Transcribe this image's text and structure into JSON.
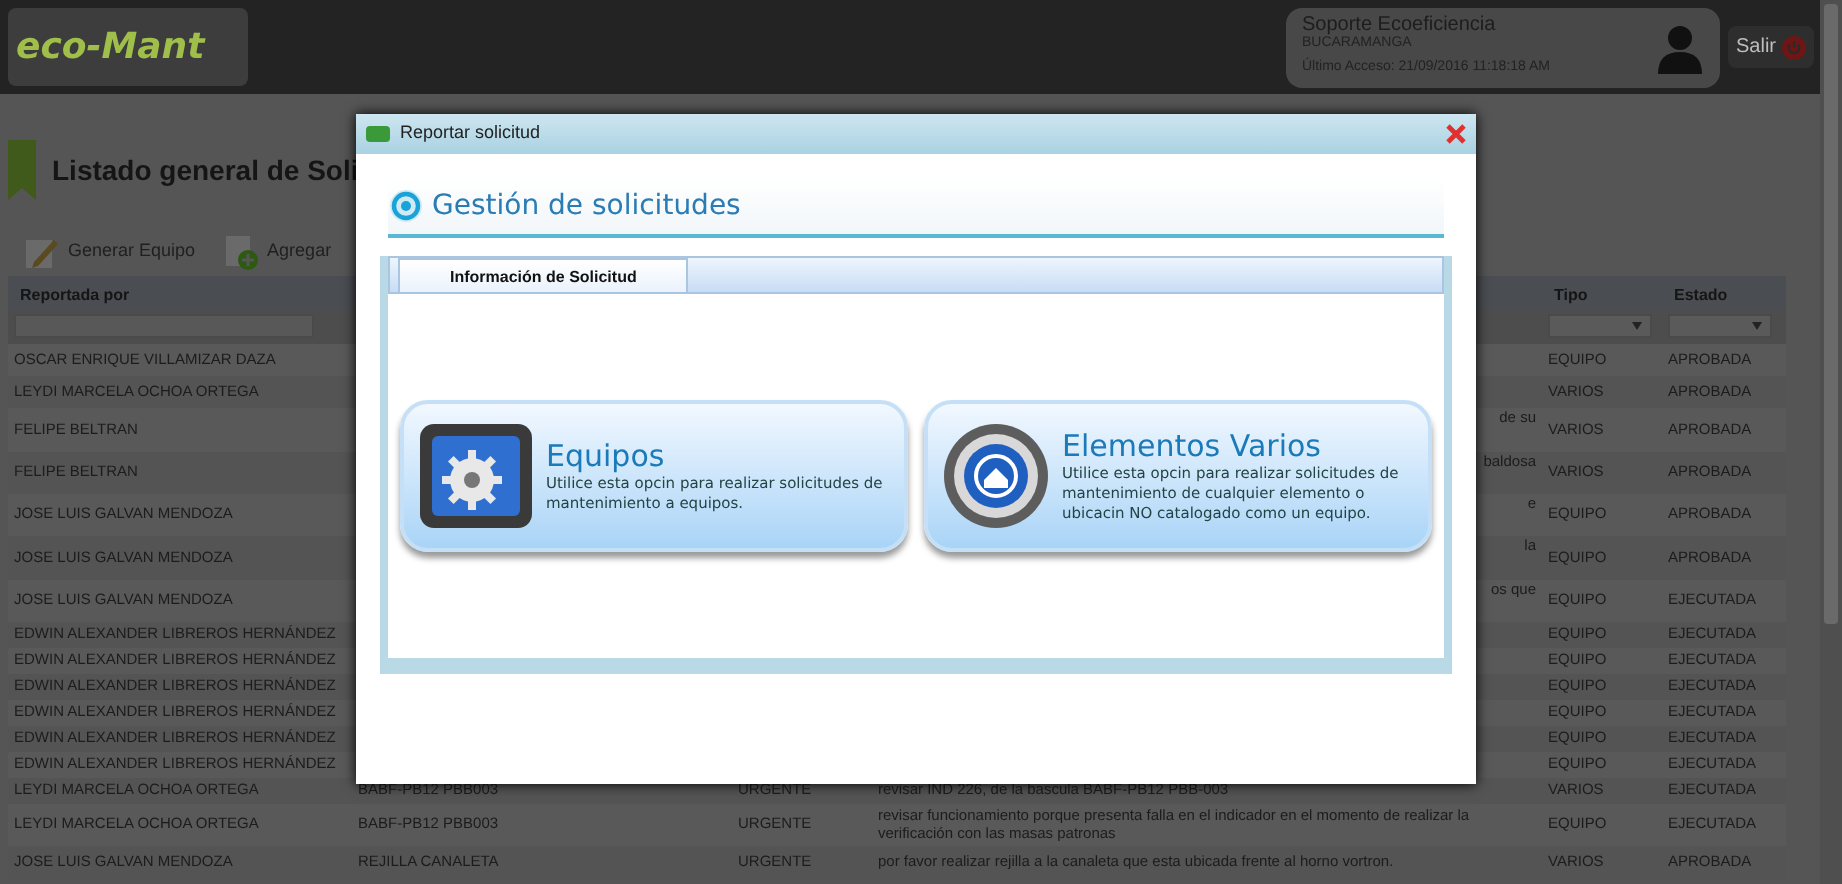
{
  "header": {
    "logo": "eco-Mant",
    "user": {
      "name": "Soporte Ecoeficiencia",
      "location": "BUCARAMANGA",
      "last_access": "Último Acceso: 21/09/2016 11:18:18 AM"
    },
    "logout": "Salir"
  },
  "page": {
    "title": "Listado general de Soli",
    "toolbar": [
      {
        "kind": "edit",
        "label": "Generar Equipo"
      },
      {
        "kind": "add",
        "label": "Agregar"
      }
    ]
  },
  "table": {
    "columns": {
      "reported_by": "Reportada por",
      "tipo": "Tipo",
      "estado": "Estado"
    },
    "rows": [
      {
        "kind": "covered",
        "reported_by": "OSCAR ENRIQUE VILLAMIZAR DAZA",
        "tipo": "EQUIPO",
        "estado": "APROBADA"
      },
      {
        "kind": "covered",
        "reported_by": "LEYDI MARCELA OCHOA ORTEGA",
        "tipo": "VARIOS",
        "estado": "APROBADA"
      },
      {
        "kind": "covered",
        "reported_by": "FELIPE BELTRAN",
        "column_4": "de su",
        "tipo": "VARIOS",
        "estado": "APROBADA"
      },
      {
        "kind": "covered",
        "reported_by": "FELIPE BELTRAN",
        "column_4": "baldosa",
        "tipo": "VARIOS",
        "estado": "APROBADA"
      },
      {
        "kind": "covered",
        "reported_by": "JOSE LUIS GALVAN MENDOZA",
        "column_4": "e",
        "tipo": "EQUIPO",
        "estado": "APROBADA"
      },
      {
        "kind": "covered",
        "reported_by": "JOSE LUIS GALVAN MENDOZA",
        "column_4": "la",
        "tipo": "EQUIPO",
        "estado": "APROBADA"
      },
      {
        "kind": "covered",
        "reported_by": "JOSE LUIS GALVAN MENDOZA",
        "column_4": "os que",
        "tipo": "EQUIPO",
        "estado": "EJECUTADA"
      },
      {
        "kind": "covered",
        "reported_by": "EDWIN ALEXANDER LIBREROS HERNÁNDEZ",
        "tipo": "EQUIPO",
        "estado": "EJECUTADA"
      },
      {
        "kind": "covered",
        "reported_by": "EDWIN ALEXANDER LIBREROS HERNÁNDEZ",
        "tipo": "EQUIPO",
        "estado": "EJECUTADA"
      },
      {
        "kind": "covered",
        "reported_by": "EDWIN ALEXANDER LIBREROS HERNÁNDEZ",
        "tipo": "EQUIPO",
        "estado": "EJECUTADA"
      },
      {
        "kind": "covered",
        "reported_by": "EDWIN ALEXANDER LIBREROS HERNÁNDEZ",
        "tipo": "EQUIPO",
        "estado": "EJECUTADA"
      },
      {
        "kind": "covered",
        "reported_by": "EDWIN ALEXANDER LIBREROS HERNÁNDEZ",
        "tipo": "EQUIPO",
        "estado": "EJECUTADA"
      },
      {
        "kind": "covered",
        "reported_by": "EDWIN ALEXANDER LIBREROS HERNÁNDEZ",
        "tipo": "EQUIPO",
        "estado": "EJECUTADA"
      },
      {
        "kind": "full",
        "reported_by": "LEYDI MARCELA OCHOA ORTEGA",
        "column_2": "BABF-PB12 PBB003",
        "column_3": "URGENTE",
        "column_4": "revisar IND 226, de la bascula BABF-PB12 PBB-003",
        "tipo": "VARIOS",
        "estado": "EJECUTADA"
      },
      {
        "kind": "full",
        "reported_by": "LEYDI MARCELA OCHOA ORTEGA",
        "column_2": "BABF-PB12 PBB003",
        "column_3": "URGENTE",
        "column_4": "revisar funcionamiento porque presenta falla en el indicador en el momento de realizar la verificación con las masas patronas",
        "tipo": "EQUIPO",
        "estado": "EJECUTADA"
      },
      {
        "kind": "full",
        "reported_by": "JOSE LUIS GALVAN MENDOZA",
        "column_2": "REJILLA CANALETA",
        "column_3": "URGENTE",
        "column_4": "por favor realizar rejilla a la canaleta que esta ubicada frente al horno vortron.",
        "tipo": "VARIOS",
        "estado": "APROBADA"
      }
    ]
  },
  "dialog": {
    "title": "Reportar solicitud",
    "heading": "Gestión de solicitudes",
    "tabs": [
      {
        "label": "Información de Solicitud",
        "selected": true
      }
    ],
    "options": [
      {
        "kind": "equipment",
        "title": "Equipos",
        "description": "Utilice esta opcin para realizar solicitudes de mantenimiento a equipos."
      },
      {
        "kind": "misc",
        "title": "Elementos Varios",
        "description": "Utilice esta opcin para realizar solicitudes de mantenimiento de cualquier elemento o ubicacin NO catalogado como un equipo."
      }
    ]
  }
}
